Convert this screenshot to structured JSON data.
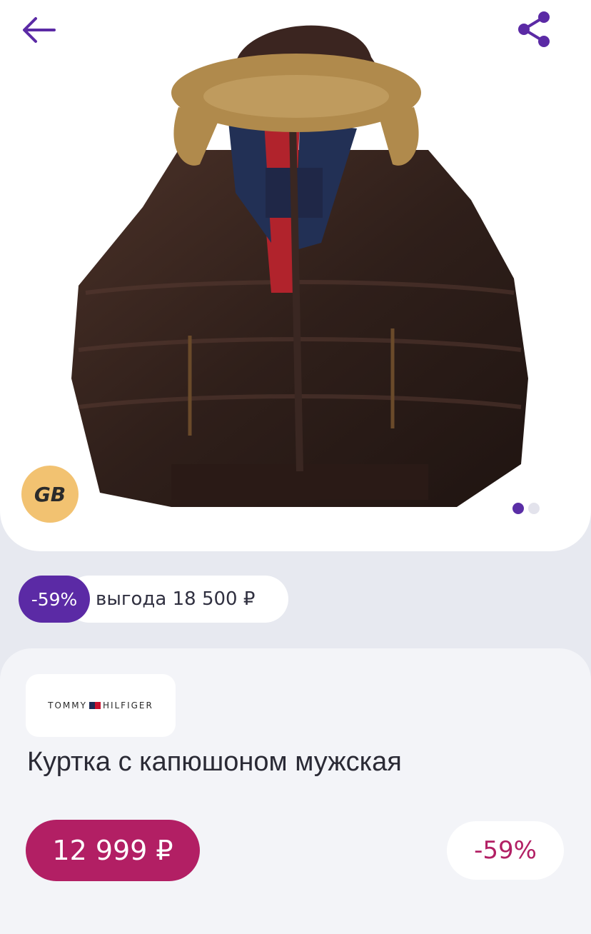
{
  "header": {
    "back_icon": "arrow-left-icon",
    "share_icon": "share-icon",
    "accent_color": "#5b2aa5"
  },
  "gallery": {
    "seller_badge": "GB",
    "slide_count": 2,
    "active_slide": 1
  },
  "benefit": {
    "percent": "-59%",
    "text": "выгода 18 500 ₽"
  },
  "product": {
    "brand_left": "TOMMY",
    "brand_right": "HILFIGER",
    "title": "Куртка с капюшоном мужская",
    "price": "12 999 ₽",
    "discount": "-59%",
    "price_color": "#b21f64"
  }
}
